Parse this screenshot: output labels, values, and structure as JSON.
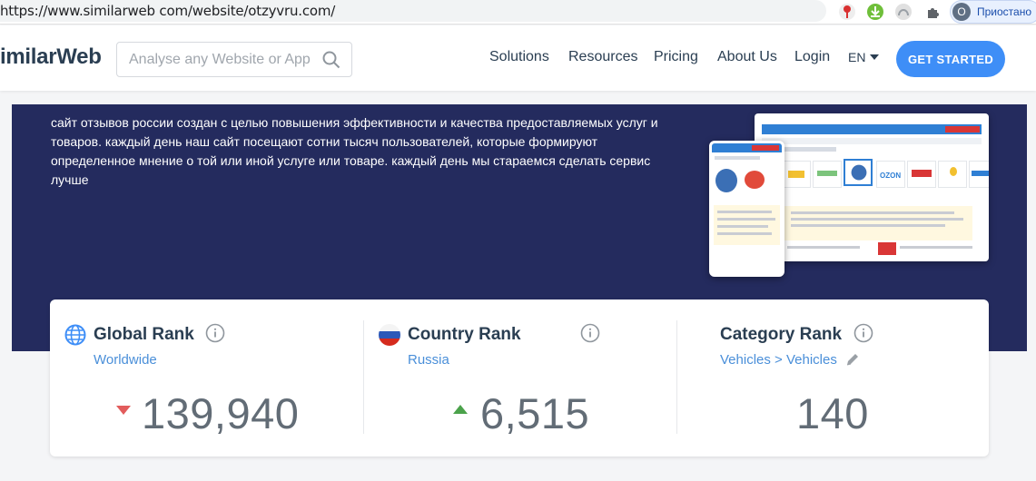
{
  "browser": {
    "url": "https://www.similarweb com/website/otzyvru.com/",
    "profile_initial": "O",
    "profile_label": "Приостано"
  },
  "header": {
    "logo": "imilarWeb",
    "search_placeholder": "Analyse any Website or App",
    "nav": [
      "Solutions",
      "Resources",
      "Pricing",
      "About Us",
      "Login"
    ],
    "language": "EN",
    "cta": "GET STARTED"
  },
  "hero": {
    "description": "сайт отзывов россии создан с целью повышения эффективности и качества предоставляемых услуг и товаров. каждый день наш сайт посещают сотни тысяч пользователей, которые формируют определенное мнение о той или иной услуге или товаре. каждый день мы стараемся сделать сервис лучше"
  },
  "ranks": {
    "global": {
      "title": "Global Rank",
      "subtitle": "Worldwide",
      "value": "139,940",
      "trend": "down"
    },
    "country": {
      "title": "Country Rank",
      "subtitle": "Russia",
      "value": "6,515",
      "trend": "up"
    },
    "category": {
      "title": "Category Rank",
      "subtitle": "Vehicles > Vehicles",
      "value": "140"
    }
  },
  "colors": {
    "accent": "#3e8ef7",
    "hero_bg": "#242b5e",
    "trend_down": "#e25c5c",
    "trend_up": "#4ba24b"
  }
}
